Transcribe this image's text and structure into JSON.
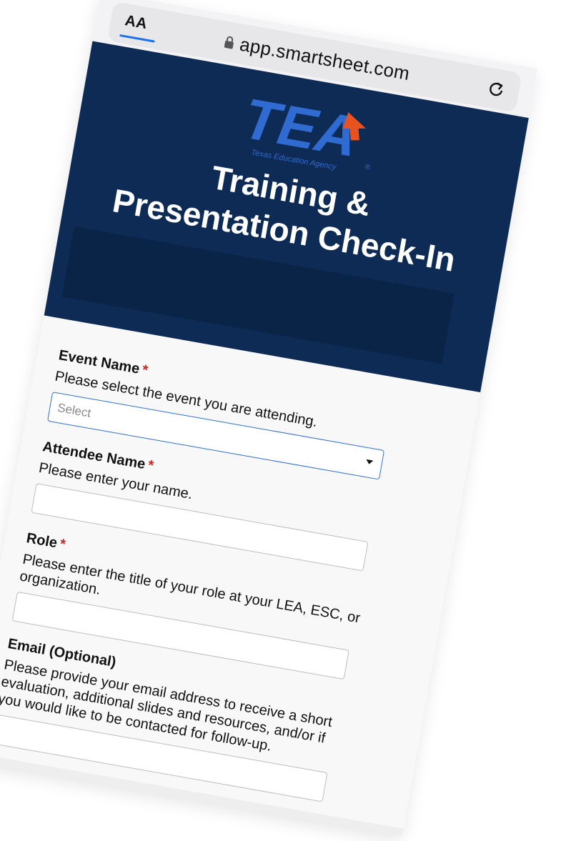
{
  "browser": {
    "text_size_label": "AA",
    "url": "app.smartsheet.com"
  },
  "header": {
    "logo": {
      "letters": "TEA",
      "tagline": "Texas Education Agency",
      "mark": "®"
    },
    "title_line1": "Training &",
    "title_line2": "Presentation Check-In"
  },
  "form": {
    "fields": [
      {
        "label": "Event Name",
        "required_mark": "*",
        "description": "Please select the event you are attending.",
        "placeholder": "Select",
        "type": "select"
      },
      {
        "label": "Attendee Name",
        "required_mark": "*",
        "description": "Please enter your name.",
        "value": "",
        "type": "text"
      },
      {
        "label": "Role",
        "required_mark": "*",
        "description": "Please enter the title of your role at your LEA, ESC, or organization.",
        "value": "",
        "type": "text"
      },
      {
        "label": "Email (Optional)",
        "description": "Please provide your email address to receive a short evaluation, additional slides and resources, and/or if you would like to be contacted for follow-up.",
        "value": "",
        "type": "text"
      }
    ]
  },
  "colors": {
    "header_bg": "#0d2b55",
    "logo_blue": "#2f6bd1",
    "logo_orange": "#e8521f",
    "required": "#c62828",
    "select_border": "#2f6fd1"
  },
  "icons": [
    "lock-icon",
    "reload-icon",
    "dropdown-caret-icon",
    "tea-logo"
  ]
}
